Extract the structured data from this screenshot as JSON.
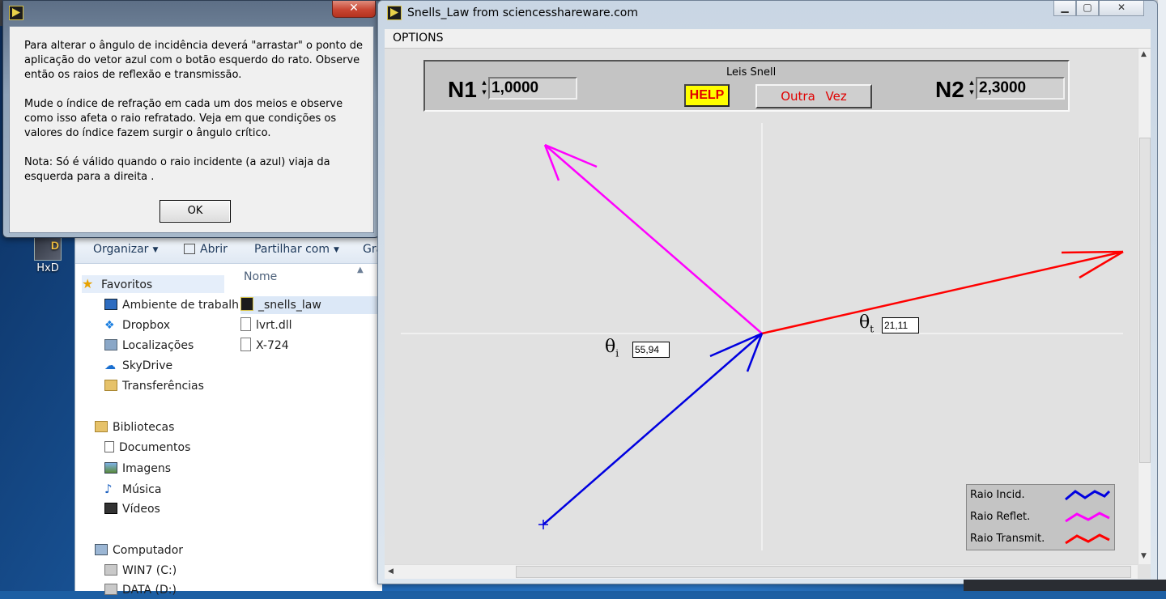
{
  "desktop": {
    "icon_label": "HxD",
    "icon_logo": "D"
  },
  "dialog": {
    "close_glyph": "✕",
    "paragraphs": [
      "Para alterar o ângulo de incidência deverá \"arrastar\" o ponto de aplicação do vetor azul com o botão esquerdo do rato. Observe então os raios de reflexão e transmissão.",
      "Mude o índice de refração em cada um dos meios e observe como isso afeta o raio refratado. Veja em que  condições os valores do índice fazem surgir o ângulo crítico.",
      "Nota: Só é válido quando o raio incidente (a azul) viaja da esquerda para a direita            ."
    ],
    "ok_label": "OK"
  },
  "explorer": {
    "toolbar": {
      "organize": "Organizar",
      "open": "Abrir",
      "share": "Partilhar com",
      "more": "Gra"
    },
    "nav": {
      "favorites_header": "Favoritos",
      "favorites": [
        "Ambiente de trabalh",
        "Dropbox",
        "Localizações",
        "SkyDrive",
        "Transferências"
      ],
      "libraries_header": "Bibliotecas",
      "libraries": [
        "Documentos",
        "Imagens",
        "Música",
        "Vídeos"
      ],
      "computer_header": "Computador",
      "drives": [
        "WIN7 (C:)",
        "DATA (D:)"
      ]
    },
    "files_header": "Nome",
    "files": [
      "_snells_law",
      "lvrt.dll",
      "X-724"
    ]
  },
  "snell": {
    "title": "Snells_Law from sciencesshareware.com",
    "menu_options": "OPTIONS",
    "panel_title": "Leis Snell",
    "n1_label": "N1",
    "n1_value": "1,0000",
    "n2_label": "N2",
    "n2_value": "2,3000",
    "help_label": "HELP",
    "again_label": "Outra Vez",
    "theta_i_value": "55,94",
    "theta_t_value": "21,11",
    "theta_symbol": "θ",
    "theta_i_sub": "i",
    "theta_t_sub": "t",
    "legend": [
      "Raio Incid.",
      "Raio Reflet.",
      "Raio Transmit."
    ]
  },
  "colors": {
    "incident": "#0000e0",
    "reflected": "#ff00ff",
    "transmitted": "#ff0000",
    "help_bg": "#ffff00",
    "button_text": "#e00000"
  }
}
